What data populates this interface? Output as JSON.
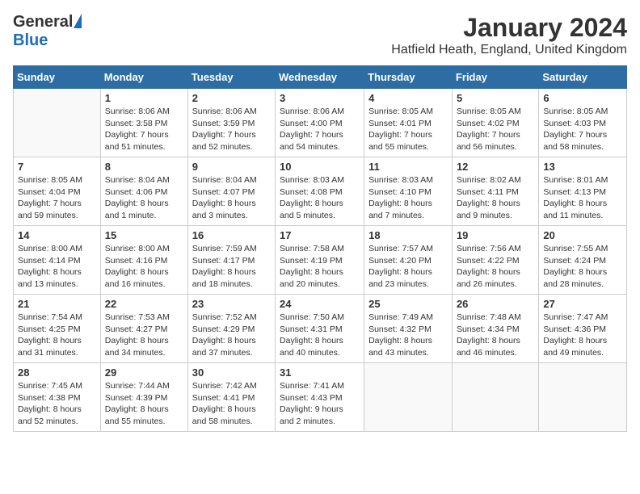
{
  "header": {
    "logo_general": "General",
    "logo_blue": "Blue",
    "month_title": "January 2024",
    "location": "Hatfield Heath, England, United Kingdom"
  },
  "days_of_week": [
    "Sunday",
    "Monday",
    "Tuesday",
    "Wednesday",
    "Thursday",
    "Friday",
    "Saturday"
  ],
  "weeks": [
    [
      {
        "day": "",
        "data": ""
      },
      {
        "day": "1",
        "data": "Sunrise: 8:06 AM\nSunset: 3:58 PM\nDaylight: 7 hours\nand 51 minutes."
      },
      {
        "day": "2",
        "data": "Sunrise: 8:06 AM\nSunset: 3:59 PM\nDaylight: 7 hours\nand 52 minutes."
      },
      {
        "day": "3",
        "data": "Sunrise: 8:06 AM\nSunset: 4:00 PM\nDaylight: 7 hours\nand 54 minutes."
      },
      {
        "day": "4",
        "data": "Sunrise: 8:05 AM\nSunset: 4:01 PM\nDaylight: 7 hours\nand 55 minutes."
      },
      {
        "day": "5",
        "data": "Sunrise: 8:05 AM\nSunset: 4:02 PM\nDaylight: 7 hours\nand 56 minutes."
      },
      {
        "day": "6",
        "data": "Sunrise: 8:05 AM\nSunset: 4:03 PM\nDaylight: 7 hours\nand 58 minutes."
      }
    ],
    [
      {
        "day": "7",
        "data": "Sunrise: 8:05 AM\nSunset: 4:04 PM\nDaylight: 7 hours\nand 59 minutes."
      },
      {
        "day": "8",
        "data": "Sunrise: 8:04 AM\nSunset: 4:06 PM\nDaylight: 8 hours\nand 1 minute."
      },
      {
        "day": "9",
        "data": "Sunrise: 8:04 AM\nSunset: 4:07 PM\nDaylight: 8 hours\nand 3 minutes."
      },
      {
        "day": "10",
        "data": "Sunrise: 8:03 AM\nSunset: 4:08 PM\nDaylight: 8 hours\nand 5 minutes."
      },
      {
        "day": "11",
        "data": "Sunrise: 8:03 AM\nSunset: 4:10 PM\nDaylight: 8 hours\nand 7 minutes."
      },
      {
        "day": "12",
        "data": "Sunrise: 8:02 AM\nSunset: 4:11 PM\nDaylight: 8 hours\nand 9 minutes."
      },
      {
        "day": "13",
        "data": "Sunrise: 8:01 AM\nSunset: 4:13 PM\nDaylight: 8 hours\nand 11 minutes."
      }
    ],
    [
      {
        "day": "14",
        "data": "Sunrise: 8:00 AM\nSunset: 4:14 PM\nDaylight: 8 hours\nand 13 minutes."
      },
      {
        "day": "15",
        "data": "Sunrise: 8:00 AM\nSunset: 4:16 PM\nDaylight: 8 hours\nand 16 minutes."
      },
      {
        "day": "16",
        "data": "Sunrise: 7:59 AM\nSunset: 4:17 PM\nDaylight: 8 hours\nand 18 minutes."
      },
      {
        "day": "17",
        "data": "Sunrise: 7:58 AM\nSunset: 4:19 PM\nDaylight: 8 hours\nand 20 minutes."
      },
      {
        "day": "18",
        "data": "Sunrise: 7:57 AM\nSunset: 4:20 PM\nDaylight: 8 hours\nand 23 minutes."
      },
      {
        "day": "19",
        "data": "Sunrise: 7:56 AM\nSunset: 4:22 PM\nDaylight: 8 hours\nand 26 minutes."
      },
      {
        "day": "20",
        "data": "Sunrise: 7:55 AM\nSunset: 4:24 PM\nDaylight: 8 hours\nand 28 minutes."
      }
    ],
    [
      {
        "day": "21",
        "data": "Sunrise: 7:54 AM\nSunset: 4:25 PM\nDaylight: 8 hours\nand 31 minutes."
      },
      {
        "day": "22",
        "data": "Sunrise: 7:53 AM\nSunset: 4:27 PM\nDaylight: 8 hours\nand 34 minutes."
      },
      {
        "day": "23",
        "data": "Sunrise: 7:52 AM\nSunset: 4:29 PM\nDaylight: 8 hours\nand 37 minutes."
      },
      {
        "day": "24",
        "data": "Sunrise: 7:50 AM\nSunset: 4:31 PM\nDaylight: 8 hours\nand 40 minutes."
      },
      {
        "day": "25",
        "data": "Sunrise: 7:49 AM\nSunset: 4:32 PM\nDaylight: 8 hours\nand 43 minutes."
      },
      {
        "day": "26",
        "data": "Sunrise: 7:48 AM\nSunset: 4:34 PM\nDaylight: 8 hours\nand 46 minutes."
      },
      {
        "day": "27",
        "data": "Sunrise: 7:47 AM\nSunset: 4:36 PM\nDaylight: 8 hours\nand 49 minutes."
      }
    ],
    [
      {
        "day": "28",
        "data": "Sunrise: 7:45 AM\nSunset: 4:38 PM\nDaylight: 8 hours\nand 52 minutes."
      },
      {
        "day": "29",
        "data": "Sunrise: 7:44 AM\nSunset: 4:39 PM\nDaylight: 8 hours\nand 55 minutes."
      },
      {
        "day": "30",
        "data": "Sunrise: 7:42 AM\nSunset: 4:41 PM\nDaylight: 8 hours\nand 58 minutes."
      },
      {
        "day": "31",
        "data": "Sunrise: 7:41 AM\nSunset: 4:43 PM\nDaylight: 9 hours\nand 2 minutes."
      },
      {
        "day": "",
        "data": ""
      },
      {
        "day": "",
        "data": ""
      },
      {
        "day": "",
        "data": ""
      }
    ]
  ]
}
